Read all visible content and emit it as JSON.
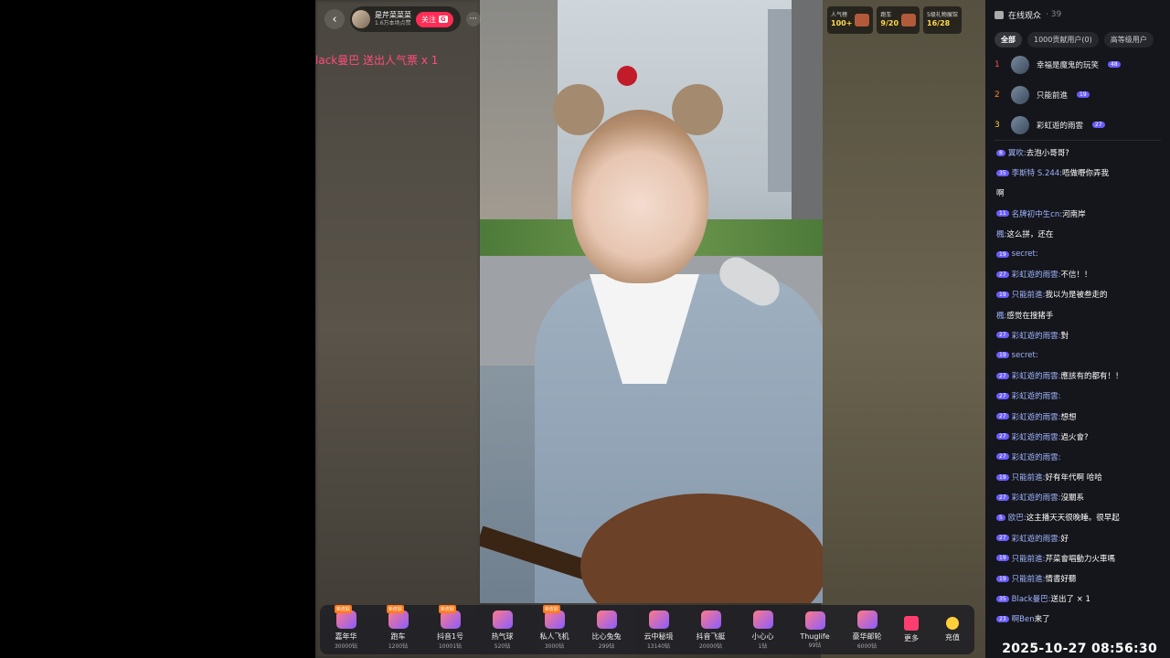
{
  "host": {
    "name": "是芹菜菜菜",
    "sub": "1.6万本场点赞",
    "follow_label": "关注",
    "badge": "G"
  },
  "gift_notice": "lack曼巴 送出人气票 x 1",
  "stats": [
    {
      "label": "人气榜",
      "value": "100+"
    },
    {
      "label": "跑车",
      "value": "9/20"
    },
    {
      "label": "5级礼物展馆",
      "value": "16/28"
    }
  ],
  "panel": {
    "title": "在线观众",
    "count": "· 39",
    "tabs": [
      "全部",
      "1000贡献用户(0)",
      "高等级用户"
    ],
    "ranks": [
      {
        "num": "1",
        "name": "幸福是魔鬼的玩笑",
        "level": "48"
      },
      {
        "num": "2",
        "name": "只能前進",
        "level": "19"
      },
      {
        "num": "3",
        "name": "彩虹遊的雨雲",
        "level": "27"
      }
    ]
  },
  "chat": [
    {
      "level": "8",
      "user": "翼吹:",
      "text": " 去泡小哥哥?"
    },
    {
      "level": "35",
      "user": "李斯特 S.244:",
      "text": " 唔做嘢你弄我"
    },
    {
      "level": "",
      "user": "",
      "text": "啊"
    },
    {
      "level": "11",
      "user": "名牌初中生cn:",
      "text": " 河南岸"
    },
    {
      "level": "",
      "user": "楓:",
      "text": " 这么拼，还在"
    },
    {
      "level": "19",
      "user": "secret:",
      "text": ""
    },
    {
      "level": "27",
      "user": "彩虹遊的雨雲:",
      "text": " 不信！！"
    },
    {
      "level": "19",
      "user": "只能前進:",
      "text": " 我以为是被叁走的"
    },
    {
      "level": "",
      "user": "楓:",
      "text": " 感觉在搜猪手"
    },
    {
      "level": "27",
      "user": "彩虹遊的雨雲:",
      "text": " 對"
    },
    {
      "level": "19",
      "user": "secret:",
      "text": ""
    },
    {
      "level": "27",
      "user": "彩虹遊的雨雲:",
      "text": " 應該有的都有！！"
    },
    {
      "level": "27",
      "user": "彩虹遊的雨雲:",
      "text": ""
    },
    {
      "level": "27",
      "user": "彩虹遊的雨雲:",
      "text": " 想想"
    },
    {
      "level": "27",
      "user": "彩虹遊的雨雲:",
      "text": " 過火會?"
    },
    {
      "level": "27",
      "user": "彩虹遊的雨雲:",
      "text": ""
    },
    {
      "level": "19",
      "user": "只能前進:",
      "text": " 好有年代啊 哈哈"
    },
    {
      "level": "27",
      "user": "彩虹遊的雨雲:",
      "text": " 沒關系"
    },
    {
      "level": "5",
      "user": "欧巴:",
      "text": " 这主播天天很晚睡。很早起"
    },
    {
      "level": "27",
      "user": "彩虹遊的雨雲:",
      "text": " 好"
    },
    {
      "level": "19",
      "user": "只能前進:",
      "text": " 芹菜會唱動力火車嗎"
    },
    {
      "level": "19",
      "user": "只能前進:",
      "text": " 情書好聽"
    },
    {
      "level": "35",
      "user": "Black曼巴:",
      "text": " 送出了  × 1"
    },
    {
      "level": "23",
      "user": "啊Ben",
      "text": " 来了"
    }
  ],
  "gifts": [
    {
      "name": "嘉年华",
      "price": "30000钻",
      "tag": "新皮肤"
    },
    {
      "name": "跑车",
      "price": "1200钻",
      "tag": "新皮肤"
    },
    {
      "name": "抖音1号",
      "price": "10001钻",
      "tag": "新皮肤"
    },
    {
      "name": "热气球",
      "price": "520钻",
      "tag": ""
    },
    {
      "name": "私人飞机",
      "price": "3000钻",
      "tag": "新皮肤"
    },
    {
      "name": "比心兔兔",
      "price": "299钻",
      "tag": ""
    },
    {
      "name": "云中秘境",
      "price": "13140钻",
      "tag": ""
    },
    {
      "name": "抖音飞艇",
      "price": "20000钻",
      "tag": ""
    },
    {
      "name": "小心心",
      "price": "1钻",
      "tag": ""
    },
    {
      "name": "Thuglife",
      "price": "99钻",
      "tag": ""
    },
    {
      "name": "豪华邮轮",
      "price": "6000钻",
      "tag": ""
    }
  ],
  "more_label": "更多",
  "recharge_label": "充值",
  "timestamp": "2025-10-27 08:56:30",
  "colors": {
    "accent": "#ff2d55",
    "panel_bg": "#15161b",
    "username": "#9fb4ff",
    "level_badge": "#6a5cff"
  }
}
